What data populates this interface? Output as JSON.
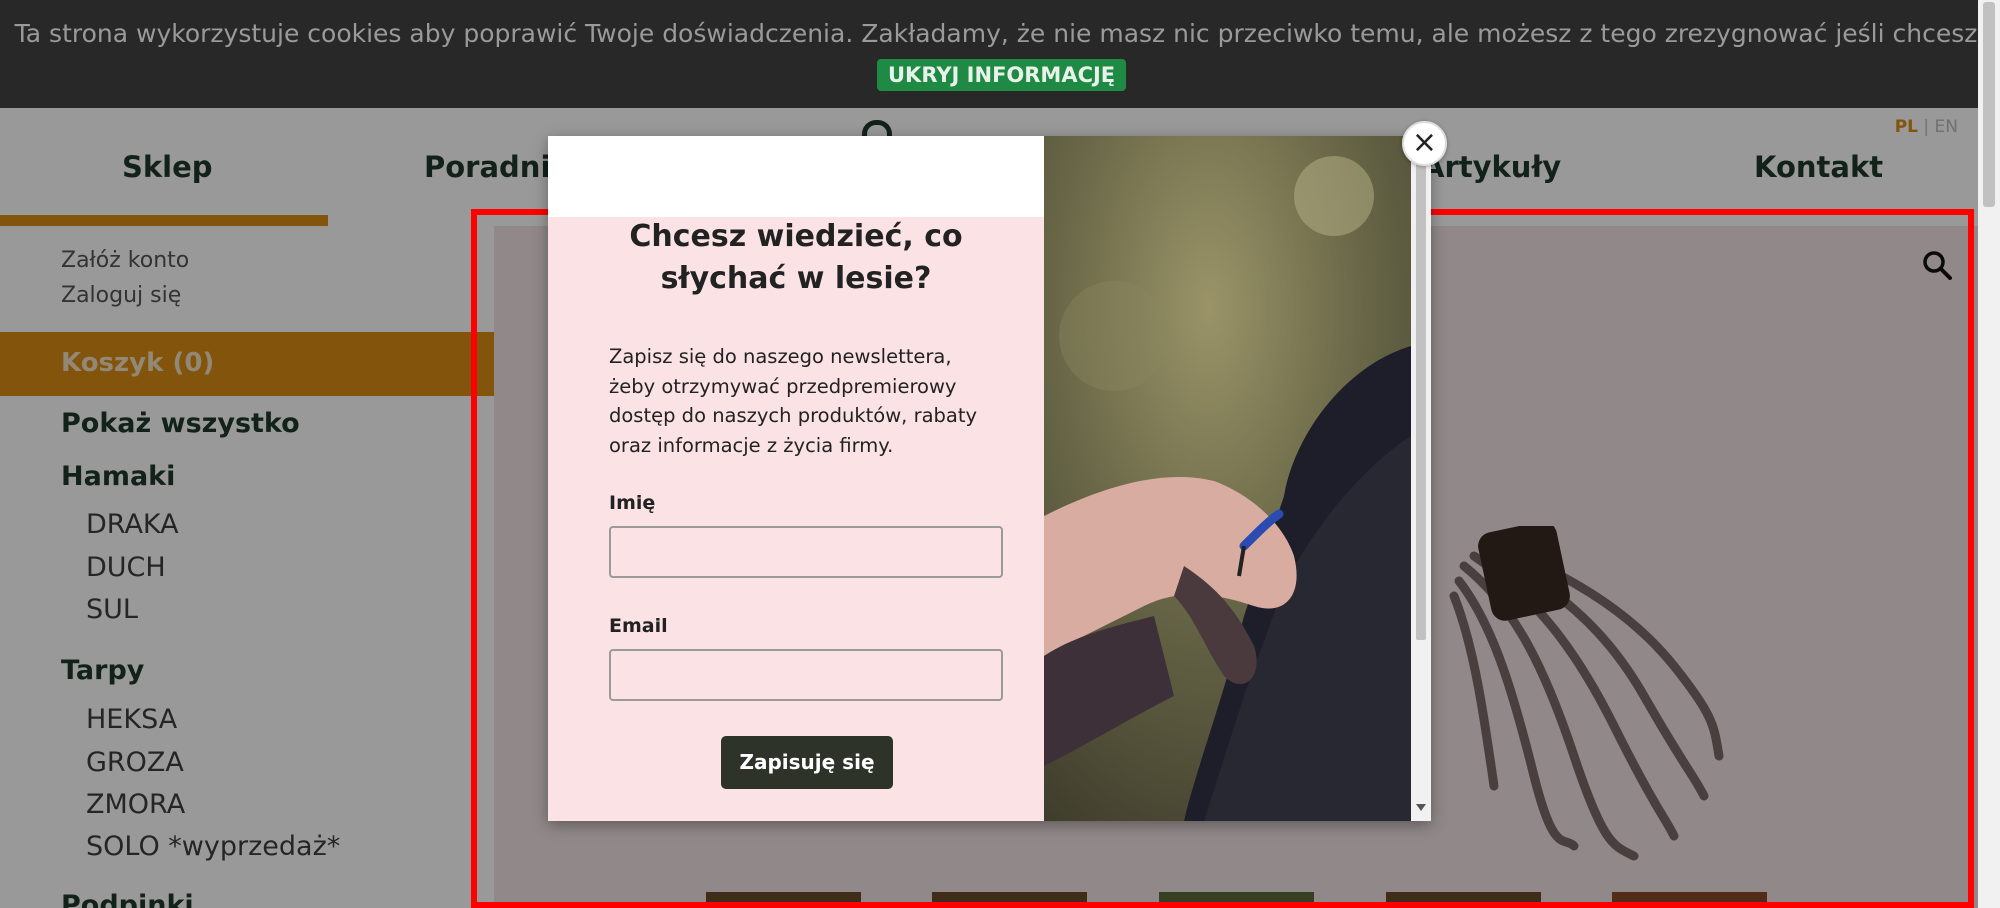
{
  "cookie_banner": {
    "text": "Ta strona wykorzystuje cookies aby poprawić Twoje doświadczenia. Zakładamy, że nie masz nic przeciwko temu, ale możesz z tego zrezygnować jeśli chcesz.",
    "button": "UKRYJ INFORMACJĘ"
  },
  "nav": {
    "items": [
      "Sklep",
      "Poradnik",
      "Artykuły",
      "Kontakt"
    ],
    "active": "Sklep",
    "lang": {
      "pl": "PL",
      "separator": "|",
      "en": "EN"
    }
  },
  "sidebar": {
    "register": "Załóż konto",
    "login": "Zaloguj się",
    "cart": "Koszyk (0)",
    "show_all": "Pokaż wszystko",
    "categories": [
      {
        "name": "Hamaki",
        "items": [
          "DRAKA",
          "DUCH",
          "SUL"
        ]
      },
      {
        "name": "Tarpy",
        "items": [
          "HEKSA",
          "GROZA",
          "ZMORA",
          "SOLO *wyprzedaż*"
        ]
      },
      {
        "name": "Podpinki"
      }
    ]
  },
  "modal": {
    "title": "Chcesz wiedzieć, co słychać w lesie?",
    "description": "Zapisz się do naszego newslettera, żeby otrzymywać przedpremierowy dostęp do naszych produktów, rabaty oraz informacje z życia firmy.",
    "name_label": "Imię",
    "name_value": "",
    "email_label": "Email",
    "email_value": "",
    "submit": "Zapisuję się",
    "close": "×"
  },
  "colors": {
    "accent": "#d98c14",
    "brand_green": "#1e3a2e",
    "cookie_btn": "#1e8a44",
    "highlight": "#ff0000"
  },
  "icons": [
    "search-icon",
    "close-icon"
  ]
}
